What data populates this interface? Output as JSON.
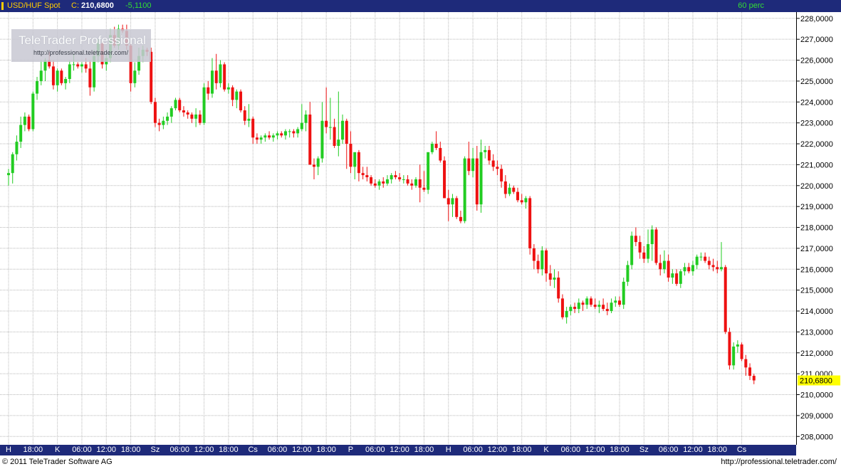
{
  "header": {
    "symbol": "USD/HUF Spot",
    "close_label": "C:",
    "close_value": "210,6800",
    "change": "-5,1100",
    "interval": "60 perc"
  },
  "watermark": {
    "brand": "TeleTrader Professional",
    "url": "http://professional.teletrader.com/"
  },
  "footer": {
    "copyright": "© 2011  TeleTrader Software AG",
    "url": "http://professional.teletrader.com/"
  },
  "colors": {
    "up": "#22cc22",
    "down": "#ee1111",
    "bar": "#1e2a7a",
    "grid": "#b8b8b8",
    "last_price_bg": "#ffff00"
  },
  "chart_data": {
    "type": "candlestick",
    "title": "USD/HUF Spot",
    "interval": "60 perc",
    "ylim": [
      207.6,
      228.3
    ],
    "y_ticks": [
      "208,0000",
      "209,0000",
      "210,0000",
      "211,0000",
      "212,0000",
      "213,0000",
      "214,0000",
      "215,0000",
      "216,0000",
      "217,0000",
      "218,0000",
      "219,0000",
      "220,0000",
      "221,0000",
      "222,0000",
      "223,0000",
      "224,0000",
      "225,0000",
      "226,0000",
      "227,0000",
      "228,0000"
    ],
    "last_price": "210,6800",
    "grid": true,
    "x_ticks": [
      {
        "label": "H",
        "slot": 0
      },
      {
        "label": "18:00",
        "slot": 6
      },
      {
        "label": "K",
        "slot": 12
      },
      {
        "label": "06:00",
        "slot": 18
      },
      {
        "label": "12:00",
        "slot": 24
      },
      {
        "label": "18:00",
        "slot": 30
      },
      {
        "label": "Sz",
        "slot": 36
      },
      {
        "label": "06:00",
        "slot": 42
      },
      {
        "label": "12:00",
        "slot": 48
      },
      {
        "label": "18:00",
        "slot": 54
      },
      {
        "label": "Cs",
        "slot": 60
      },
      {
        "label": "06:00",
        "slot": 66
      },
      {
        "label": "12:00",
        "slot": 72
      },
      {
        "label": "18:00",
        "slot": 78
      },
      {
        "label": "P",
        "slot": 84
      },
      {
        "label": "06:00",
        "slot": 90
      },
      {
        "label": "12:00",
        "slot": 96
      },
      {
        "label": "18:00",
        "slot": 102
      },
      {
        "label": "H",
        "slot": 108
      },
      {
        "label": "06:00",
        "slot": 114
      },
      {
        "label": "12:00",
        "slot": 120
      },
      {
        "label": "18:00",
        "slot": 126
      },
      {
        "label": "K",
        "slot": 132
      },
      {
        "label": "06:00",
        "slot": 138
      },
      {
        "label": "12:00",
        "slot": 144
      },
      {
        "label": "18:00",
        "slot": 150
      },
      {
        "label": "Sz",
        "slot": 156
      },
      {
        "label": "06:00",
        "slot": 162
      },
      {
        "label": "12:00",
        "slot": 168
      },
      {
        "label": "18:00",
        "slot": 174
      },
      {
        "label": "Cs",
        "slot": 180
      }
    ],
    "candles": [
      [
        220.5,
        220.8,
        220.0,
        220.6
      ],
      [
        220.6,
        221.6,
        220.1,
        221.5
      ],
      [
        221.5,
        222.4,
        221.2,
        222.1
      ],
      [
        222.1,
        223.3,
        221.8,
        222.9
      ],
      [
        222.9,
        223.5,
        222.6,
        223.3
      ],
      [
        223.3,
        223.4,
        222.6,
        222.7
      ],
      [
        222.7,
        224.5,
        222.6,
        224.4
      ],
      [
        224.4,
        225.2,
        224.1,
        225.0
      ],
      [
        225.0,
        226.0,
        224.8,
        225.5
      ],
      [
        225.5,
        226.1,
        225.0,
        226.0
      ],
      [
        226.0,
        226.4,
        225.6,
        225.7
      ],
      [
        225.7,
        226.0,
        224.6,
        224.8
      ],
      [
        224.8,
        225.6,
        224.5,
        225.5
      ],
      [
        225.5,
        225.6,
        224.8,
        224.9
      ],
      [
        224.9,
        225.2,
        224.6,
        225.1
      ],
      [
        225.1,
        226.0,
        224.9,
        225.8
      ],
      [
        225.8,
        226.3,
        225.5,
        225.8
      ],
      [
        225.8,
        225.9,
        225.6,
        225.7
      ],
      [
        225.7,
        225.9,
        225.4,
        225.8
      ],
      [
        225.8,
        226.1,
        225.4,
        225.6
      ],
      [
        225.6,
        226.0,
        224.3,
        224.7
      ],
      [
        224.7,
        226.5,
        224.5,
        226.2
      ],
      [
        226.2,
        227.0,
        225.9,
        226.8
      ],
      [
        226.8,
        226.9,
        225.6,
        225.8
      ],
      [
        225.8,
        226.3,
        225.5,
        226.1
      ],
      [
        226.1,
        227.5,
        225.9,
        227.2
      ],
      [
        227.2,
        227.6,
        226.6,
        226.7
      ],
      [
        226.7,
        227.7,
        226.5,
        227.5
      ],
      [
        227.5,
        227.7,
        227.3,
        227.4
      ],
      [
        227.4,
        227.7,
        226.5,
        226.7
      ],
      [
        226.7,
        226.8,
        224.5,
        224.9
      ],
      [
        224.9,
        225.9,
        224.7,
        225.5
      ],
      [
        225.5,
        226.6,
        225.3,
        226.2
      ],
      [
        226.2,
        226.7,
        225.9,
        226.5
      ],
      [
        226.5,
        226.6,
        226.2,
        226.4
      ],
      [
        226.4,
        226.6,
        223.9,
        224.0
      ],
      [
        224.0,
        224.2,
        222.8,
        223.0
      ],
      [
        223.0,
        223.2,
        222.6,
        222.9
      ],
      [
        222.9,
        223.3,
        222.7,
        223.1
      ],
      [
        223.1,
        223.5,
        222.9,
        223.3
      ],
      [
        223.3,
        223.8,
        223.0,
        223.7
      ],
      [
        223.7,
        224.2,
        223.6,
        224.1
      ],
      [
        224.1,
        224.2,
        223.5,
        223.6
      ],
      [
        223.6,
        223.8,
        223.3,
        223.5
      ],
      [
        223.5,
        223.6,
        223.2,
        223.4
      ],
      [
        223.4,
        223.5,
        223.0,
        223.2
      ],
      [
        223.2,
        223.7,
        222.8,
        223.4
      ],
      [
        223.4,
        223.6,
        222.9,
        223.0
      ],
      [
        223.0,
        224.9,
        222.9,
        224.7
      ],
      [
        224.7,
        225.0,
        224.1,
        224.4
      ],
      [
        224.4,
        226.1,
        224.2,
        225.5
      ],
      [
        225.5,
        226.3,
        224.6,
        224.9
      ],
      [
        224.9,
        226.0,
        224.7,
        225.8
      ],
      [
        225.8,
        225.9,
        224.5,
        224.6
      ],
      [
        224.6,
        224.9,
        224.4,
        224.7
      ],
      [
        224.7,
        224.8,
        223.8,
        224.1
      ],
      [
        224.1,
        224.6,
        223.7,
        224.5
      ],
      [
        224.5,
        224.6,
        223.5,
        223.6
      ],
      [
        223.6,
        223.8,
        222.9,
        223.1
      ],
      [
        223.1,
        223.9,
        222.8,
        223.2
      ],
      [
        223.2,
        223.3,
        222.0,
        222.3
      ],
      [
        222.3,
        222.5,
        222.0,
        222.2
      ],
      [
        222.2,
        222.4,
        222.0,
        222.3
      ],
      [
        222.3,
        222.5,
        222.1,
        222.4
      ],
      [
        222.4,
        222.6,
        222.2,
        222.3
      ],
      [
        222.3,
        222.5,
        222.1,
        222.4
      ],
      [
        222.4,
        222.6,
        222.2,
        222.5
      ],
      [
        222.5,
        222.6,
        222.3,
        222.4
      ],
      [
        222.4,
        222.7,
        222.2,
        222.6
      ],
      [
        222.6,
        222.7,
        222.3,
        222.6
      ],
      [
        222.6,
        222.7,
        222.3,
        222.5
      ],
      [
        222.5,
        222.8,
        222.3,
        222.7
      ],
      [
        222.7,
        223.9,
        222.6,
        223.0
      ],
      [
        223.0,
        223.6,
        222.6,
        223.4
      ],
      [
        223.4,
        224.0,
        221.0,
        221.0
      ],
      [
        221.0,
        221.3,
        220.3,
        220.9
      ],
      [
        220.9,
        221.4,
        220.5,
        221.3
      ],
      [
        221.3,
        224.0,
        221.1,
        223.1
      ],
      [
        223.1,
        224.7,
        222.5,
        222.8
      ],
      [
        222.8,
        224.2,
        222.2,
        222.8
      ],
      [
        222.8,
        223.2,
        221.8,
        221.9
      ],
      [
        221.9,
        224.5,
        221.4,
        222.2
      ],
      [
        222.2,
        223.4,
        222.0,
        223.1
      ],
      [
        223.1,
        223.2,
        220.8,
        222.0
      ],
      [
        222.0,
        222.6,
        220.6,
        220.9
      ],
      [
        220.9,
        221.4,
        220.3,
        221.6
      ],
      [
        221.6,
        221.7,
        220.2,
        220.6
      ],
      [
        220.6,
        220.9,
        220.3,
        220.5
      ],
      [
        220.5,
        220.9,
        220.2,
        220.4
      ],
      [
        220.4,
        220.5,
        220.0,
        220.1
      ],
      [
        220.1,
        220.3,
        219.9,
        220.0
      ],
      [
        220.0,
        220.3,
        219.8,
        220.2
      ],
      [
        220.2,
        220.4,
        219.9,
        220.1
      ],
      [
        220.1,
        220.5,
        220.0,
        220.3
      ],
      [
        220.3,
        220.6,
        220.1,
        220.5
      ],
      [
        220.5,
        220.7,
        220.3,
        220.4
      ],
      [
        220.4,
        220.6,
        220.2,
        220.3
      ],
      [
        220.3,
        220.5,
        220.1,
        220.3
      ],
      [
        220.3,
        220.5,
        220.0,
        220.1
      ],
      [
        220.1,
        220.3,
        219.8,
        220.0
      ],
      [
        220.0,
        220.4,
        219.9,
        220.3
      ],
      [
        220.3,
        221.0,
        219.2,
        219.9
      ],
      [
        219.9,
        220.7,
        219.7,
        219.8
      ],
      [
        219.8,
        221.4,
        219.6,
        221.6
      ],
      [
        221.6,
        222.1,
        221.5,
        222.0
      ],
      [
        222.0,
        222.6,
        221.7,
        221.8
      ],
      [
        221.8,
        222.1,
        221.1,
        221.2
      ],
      [
        221.2,
        221.4,
        219.4,
        219.4
      ],
      [
        219.4,
        219.8,
        218.3,
        219.1
      ],
      [
        219.1,
        219.6,
        218.5,
        219.4
      ],
      [
        219.4,
        219.5,
        218.4,
        218.5
      ],
      [
        218.5,
        218.8,
        218.2,
        218.3
      ],
      [
        218.3,
        221.4,
        218.2,
        221.3
      ],
      [
        221.3,
        222.1,
        220.5,
        220.7
      ],
      [
        220.7,
        221.8,
        220.4,
        221.3
      ],
      [
        221.3,
        221.9,
        218.8,
        219.1
      ],
      [
        219.1,
        222.2,
        218.7,
        221.6
      ],
      [
        221.6,
        221.9,
        221.3,
        221.7
      ],
      [
        221.7,
        221.9,
        221.0,
        221.2
      ],
      [
        221.2,
        221.5,
        220.7,
        220.9
      ],
      [
        220.9,
        221.2,
        220.5,
        220.8
      ],
      [
        220.8,
        221.0,
        219.9,
        220.2
      ],
      [
        220.2,
        220.5,
        219.4,
        219.6
      ],
      [
        219.6,
        220.1,
        219.5,
        219.9
      ],
      [
        219.9,
        220.0,
        219.6,
        219.7
      ],
      [
        219.7,
        219.9,
        219.2,
        219.3
      ],
      [
        219.3,
        219.6,
        219.1,
        219.2
      ],
      [
        219.2,
        219.5,
        218.9,
        219.4
      ],
      [
        219.4,
        219.5,
        216.7,
        217.0
      ],
      [
        217.0,
        217.2,
        216.0,
        216.4
      ],
      [
        216.4,
        216.7,
        215.8,
        216.0
      ],
      [
        216.0,
        217.1,
        215.7,
        216.9
      ],
      [
        216.9,
        217.0,
        215.4,
        215.8
      ],
      [
        215.8,
        216.2,
        215.2,
        215.5
      ],
      [
        215.5,
        216.0,
        215.1,
        215.6
      ],
      [
        215.6,
        215.9,
        214.4,
        214.6
      ],
      [
        214.6,
        214.8,
        213.6,
        213.7
      ],
      [
        213.7,
        214.2,
        213.4,
        214.0
      ],
      [
        214.0,
        214.3,
        213.8,
        214.2
      ],
      [
        214.2,
        214.4,
        213.9,
        214.1
      ],
      [
        214.1,
        214.6,
        213.9,
        214.4
      ],
      [
        214.4,
        214.5,
        214.0,
        214.3
      ],
      [
        214.3,
        214.7,
        214.1,
        214.6
      ],
      [
        214.6,
        214.7,
        214.2,
        214.3
      ],
      [
        214.3,
        214.6,
        214.1,
        214.2
      ],
      [
        214.2,
        214.5,
        213.9,
        214.3
      ],
      [
        214.3,
        214.6,
        214.0,
        214.1
      ],
      [
        214.1,
        214.4,
        213.8,
        214.0
      ],
      [
        214.0,
        214.6,
        213.9,
        214.4
      ],
      [
        214.4,
        214.7,
        214.2,
        214.5
      ],
      [
        214.5,
        214.7,
        214.2,
        214.3
      ],
      [
        214.3,
        215.6,
        214.1,
        215.4
      ],
      [
        215.4,
        216.4,
        215.2,
        216.2
      ],
      [
        216.2,
        217.8,
        216.0,
        217.6
      ],
      [
        217.6,
        218.0,
        217.1,
        217.3
      ],
      [
        217.3,
        217.6,
        216.5,
        216.8
      ],
      [
        216.8,
        217.1,
        216.3,
        216.5
      ],
      [
        216.5,
        217.9,
        216.3,
        217.2
      ],
      [
        217.2,
        218.1,
        216.4,
        217.9
      ],
      [
        217.9,
        218.0,
        216.2,
        216.3
      ],
      [
        216.3,
        216.7,
        215.7,
        216.0
      ],
      [
        216.0,
        216.9,
        215.8,
        216.4
      ],
      [
        216.4,
        216.7,
        215.4,
        215.6
      ],
      [
        215.6,
        216.0,
        215.3,
        215.8
      ],
      [
        215.8,
        216.0,
        215.2,
        215.3
      ],
      [
        215.3,
        216.0,
        215.1,
        215.9
      ],
      [
        215.9,
        216.3,
        215.7,
        216.1
      ],
      [
        216.1,
        216.3,
        215.8,
        215.9
      ],
      [
        215.9,
        216.4,
        215.7,
        216.2
      ],
      [
        216.2,
        216.7,
        216.0,
        216.6
      ],
      [
        216.6,
        216.8,
        216.4,
        216.6
      ],
      [
        216.6,
        216.8,
        216.3,
        216.4
      ],
      [
        216.4,
        216.6,
        216.0,
        216.2
      ],
      [
        216.2,
        216.5,
        215.9,
        216.1
      ],
      [
        216.1,
        216.4,
        215.8,
        216.0
      ],
      [
        216.0,
        217.3,
        215.9,
        216.1
      ],
      [
        216.1,
        216.2,
        212.9,
        213.0
      ],
      [
        213.0,
        213.2,
        211.2,
        211.4
      ],
      [
        211.4,
        212.5,
        211.2,
        212.3
      ],
      [
        212.3,
        212.6,
        212.0,
        212.4
      ],
      [
        212.4,
        212.5,
        211.6,
        211.7
      ],
      [
        211.7,
        211.9,
        210.9,
        211.3
      ],
      [
        211.3,
        211.5,
        210.7,
        210.9
      ],
      [
        210.9,
        211.0,
        210.5,
        210.68
      ]
    ]
  }
}
